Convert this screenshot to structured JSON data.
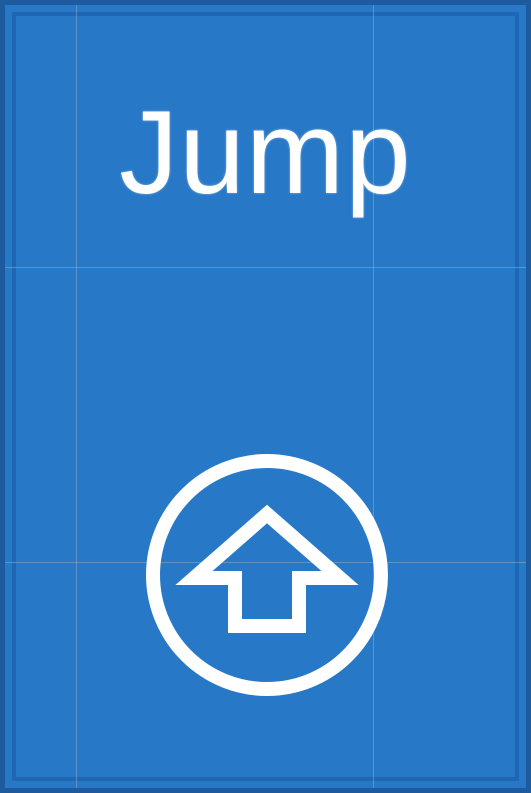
{
  "button": {
    "label": "Jump",
    "icon": "arrow-up-circle-icon"
  },
  "colors": {
    "background": "#2878c8",
    "border": "#1d5a9e",
    "foreground": "#ffffff"
  }
}
